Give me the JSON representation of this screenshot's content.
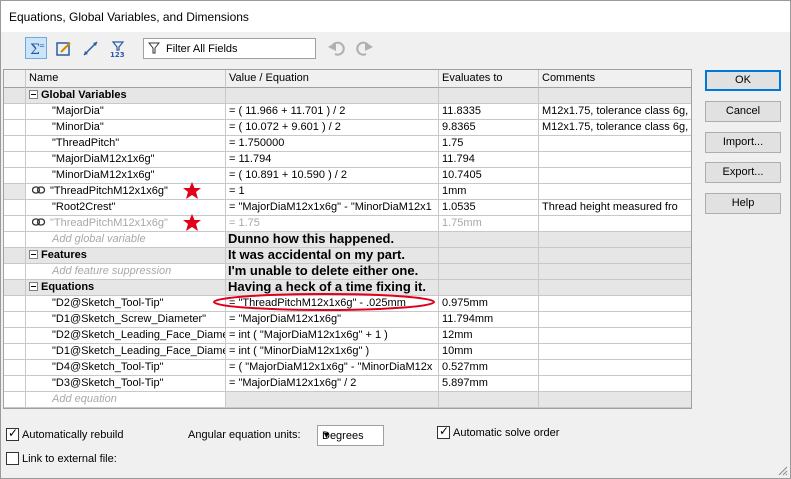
{
  "window": {
    "title": "Equations, Global Variables, and Dimensions"
  },
  "toolbar": {
    "buttons": [
      {
        "icon": "equation-view-icon",
        "active": true
      },
      {
        "icon": "sketch-equation-view-icon",
        "active": false
      },
      {
        "icon": "dimension-view-icon",
        "active": false
      },
      {
        "icon": "ordered-view-icon",
        "active": false
      }
    ],
    "filter_placeholder": "Filter All Fields"
  },
  "table": {
    "headers": [
      "Name",
      "Value / Equation",
      "Evaluates to",
      "Comments"
    ],
    "groups": {
      "global_variables": "Global Variables",
      "features": "Features",
      "equations": "Equations"
    },
    "global_rows": [
      {
        "name": "\"MajorDia\"",
        "value": "= ( 11.966 + 11.701 ) / 2",
        "eval": "11.8335",
        "comment": "M12x1.75, tolerance class 6g,"
      },
      {
        "name": "\"MinorDia\"",
        "value": "= ( 10.072 + 9.601 ) / 2",
        "eval": "9.8365",
        "comment": "M12x1.75, tolerance class 6g,"
      },
      {
        "name": "\"ThreadPitch\"",
        "value": "= 1.750000",
        "eval": "1.75",
        "comment": ""
      },
      {
        "name": "\"MajorDiaM12x1x6g\"",
        "value": "= 11.794",
        "eval": "11.794",
        "comment": ""
      },
      {
        "name": "\"MinorDiaM12x1x6g\"",
        "value": "= ( 10.891 + 10.590 ) / 2",
        "eval": "10.7405",
        "comment": ""
      },
      {
        "name": "\"ThreadPitchM12x1x6g\"",
        "value": "= 1",
        "eval": "1mm",
        "comment": ""
      },
      {
        "name": "\"Root2Crest\"",
        "value": "= \"MajorDiaM12x1x6g\" - \"MinorDiaM12x1",
        "eval": "1.0535",
        "comment": "Thread height measured fro"
      },
      {
        "name": "\"ThreadPitchM12x1x6g\"",
        "value": "= 1.75",
        "eval": "1.75mm",
        "comment": ""
      }
    ],
    "add_global": "Add global variable",
    "add_feature": "Add feature suppression",
    "equation_rows": [
      {
        "name": "\"D2@Sketch_Tool-Tip\"",
        "value": "= \"ThreadPitchM12x1x6g\" - .025mm",
        "eval": "0.975mm"
      },
      {
        "name": "\"D1@Sketch_Screw_Diameter\"",
        "value": "= \"MajorDiaM12x1x6g\"",
        "eval": "11.794mm"
      },
      {
        "name": "\"D2@Sketch_Leading_Face_Diame",
        "value": "= int ( \"MajorDiaM12x1x6g\" + 1 )",
        "eval": "12mm"
      },
      {
        "name": "\"D1@Sketch_Leading_Face_Diame",
        "value": "= int ( \"MinorDiaM12x1x6g\" )",
        "eval": "10mm"
      },
      {
        "name": "\"D4@Sketch_Tool-Tip\"",
        "value": "= ( \"MajorDiaM12x1x6g\" - \"MinorDiaM12x",
        "eval": "0.527mm"
      },
      {
        "name": "\"D3@Sketch_Tool-Tip\"",
        "value": "= \"MajorDiaM12x1x6g\" / 2",
        "eval": "5.897mm"
      }
    ],
    "add_equation": "Add equation"
  },
  "annotations": {
    "line1": "Dunno how this happened.",
    "line2": "It was accidental on my part.",
    "line3": "I'm unable to delete either one.",
    "line4": "Having a heck of a time fixing it.",
    "mark_color": "#e0001a"
  },
  "buttons": {
    "ok": "OK",
    "cancel": "Cancel",
    "import": "Import...",
    "export": "Export...",
    "help": "Help"
  },
  "options": {
    "auto_rebuild": "Automatically rebuild",
    "auto_rebuild_checked": true,
    "angular_units_label": "Angular equation units:",
    "angular_units_value": "Degrees",
    "auto_solve": "Automatic solve order",
    "auto_solve_checked": true,
    "link_external": "Link to external file:",
    "link_external_checked": false
  }
}
